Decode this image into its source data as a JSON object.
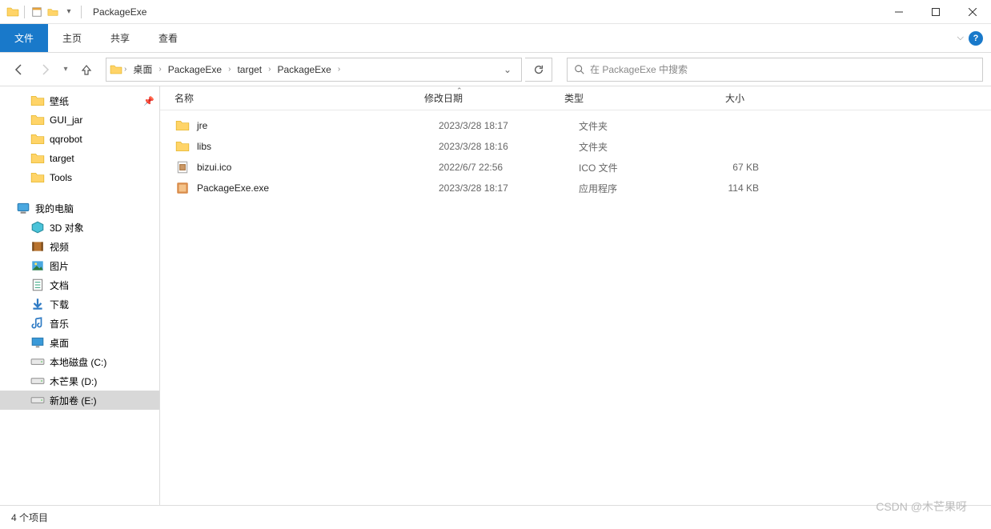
{
  "window": {
    "title": "PackageExe",
    "sep": "|"
  },
  "ribbon": {
    "file": "文件",
    "home": "主页",
    "share": "共享",
    "view": "查看"
  },
  "nav": {
    "back_label": "后退",
    "fwd_label": "前进"
  },
  "breadcrumb": {
    "items": [
      "桌面",
      "PackageExe",
      "target",
      "PackageExe"
    ]
  },
  "search": {
    "placeholder": "在 PackageExe 中搜索"
  },
  "sidebar": {
    "quick": [
      {
        "label": "壁纸",
        "pinned": true
      },
      {
        "label": "GUI_jar"
      },
      {
        "label": "qqrobot"
      },
      {
        "label": "target"
      },
      {
        "label": "Tools"
      }
    ],
    "thispc_label": "我的电脑",
    "thispc": [
      {
        "label": "3D 对象",
        "icon": "3d"
      },
      {
        "label": "视频",
        "icon": "video"
      },
      {
        "label": "图片",
        "icon": "picture"
      },
      {
        "label": "文档",
        "icon": "document"
      },
      {
        "label": "下载",
        "icon": "download"
      },
      {
        "label": "音乐",
        "icon": "music"
      },
      {
        "label": "桌面",
        "icon": "desktop"
      },
      {
        "label": "本地磁盘 (C:)",
        "icon": "drive"
      },
      {
        "label": "木芒果 (D:)",
        "icon": "drive"
      },
      {
        "label": "新加卷 (E:)",
        "icon": "drive",
        "selected": true
      }
    ]
  },
  "columns": {
    "name": "名称",
    "date": "修改日期",
    "type": "类型",
    "size": "大小"
  },
  "files": [
    {
      "name": "jre",
      "date": "2023/3/28 18:17",
      "type": "文件夹",
      "size": "",
      "icon": "folder"
    },
    {
      "name": "libs",
      "date": "2023/3/28 18:16",
      "type": "文件夹",
      "size": "",
      "icon": "folder"
    },
    {
      "name": "bizui.ico",
      "date": "2022/6/7 22:56",
      "type": "ICO 文件",
      "size": "67 KB",
      "icon": "ico"
    },
    {
      "name": "PackageExe.exe",
      "date": "2023/3/28 18:17",
      "type": "应用程序",
      "size": "114 KB",
      "icon": "exe"
    }
  ],
  "status": {
    "text": "4 个项目"
  },
  "watermark": "CSDN @木芒果呀"
}
